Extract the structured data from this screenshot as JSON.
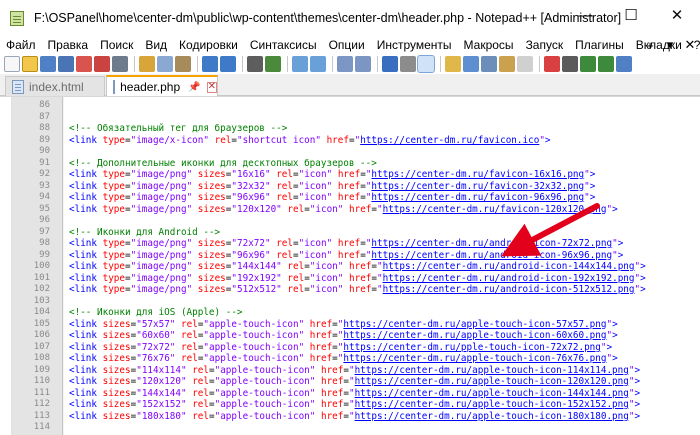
{
  "window": {
    "title": "F:\\OSPanel\\home\\center-dm\\public\\wp-content\\themes\\center-dm\\header.php - Notepad++ [Administrator]",
    "minimize": "—",
    "maximize": "☐",
    "close": "✕"
  },
  "menu": {
    "items": [
      "Файл",
      "Правка",
      "Поиск",
      "Вид",
      "Кодировки",
      "Синтаксисы",
      "Опции",
      "Инструменты",
      "Макросы",
      "Запуск",
      "Плагины",
      "Вкладки",
      "?"
    ],
    "right_plus": "+",
    "right_down": "▾",
    "right_close": "✕"
  },
  "tabs": [
    {
      "label": "index.html",
      "active": false
    },
    {
      "label": "header.php",
      "active": true
    }
  ],
  "colors": {
    "comment": "#008000",
    "tag": "#0000ff",
    "attribute": "#ff0000",
    "value": "#8000ff",
    "arrow": "#e3001b",
    "active_tab_accent": "#f6a300"
  },
  "editor": {
    "lines": [
      {
        "n": "86",
        "text": ""
      },
      {
        "n": "87",
        "text": ""
      },
      {
        "n": "88",
        "text": "<!-- Обязательный тег для браузеров -->"
      },
      {
        "n": "89",
        "text": "<link type=\"image/x-icon\" rel=\"shortcut icon\" href=\"https://center-dm.ru/favicon.ico\">"
      },
      {
        "n": "90",
        "text": ""
      },
      {
        "n": "91",
        "text": "<!-- Дополнительные иконки для десктопных браузеров -->"
      },
      {
        "n": "92",
        "text": "<link type=\"image/png\" sizes=\"16x16\" rel=\"icon\" href=\"https://center-dm.ru/favicon-16x16.png\">"
      },
      {
        "n": "93",
        "text": "<link type=\"image/png\" sizes=\"32x32\" rel=\"icon\" href=\"https://center-dm.ru/favicon-32x32.png\">"
      },
      {
        "n": "94",
        "text": "<link type=\"image/png\" sizes=\"96x96\" rel=\"icon\" href=\"https://center-dm.ru/favicon-96x96.png\">"
      },
      {
        "n": "95",
        "text": "<link type=\"image/png\" sizes=\"120x120\" rel=\"icon\" href=\"https://center-dm.ru/favicon-120x120.png\">"
      },
      {
        "n": "96",
        "text": ""
      },
      {
        "n": "97",
        "text": "<!-- Иконки для Android -->"
      },
      {
        "n": "98",
        "text": "<link type=\"image/png\" sizes=\"72x72\" rel=\"icon\" href=\"https://center-dm.ru/android-icon-72x72.png\">"
      },
      {
        "n": "99",
        "text": "<link type=\"image/png\" sizes=\"96x96\" rel=\"icon\" href=\"https://center-dm.ru/android-icon-96x96.png\">"
      },
      {
        "n": "100",
        "text": "<link type=\"image/png\" sizes=\"144x144\" rel=\"icon\" href=\"https://center-dm.ru/android-icon-144x144.png\">"
      },
      {
        "n": "101",
        "text": "<link type=\"image/png\" sizes=\"192x192\" rel=\"icon\" href=\"https://center-dm.ru/android-icon-192x192.png\">"
      },
      {
        "n": "102",
        "text": "<link type=\"image/png\" sizes=\"512x512\" rel=\"icon\" href=\"https://center-dm.ru/android-icon-512x512.png\">"
      },
      {
        "n": "103",
        "text": ""
      },
      {
        "n": "104",
        "text": "<!-- Иконки для iOS (Apple) -->"
      },
      {
        "n": "105",
        "text": "<link sizes=\"57x57\" rel=\"apple-touch-icon\" href=\"https://center-dm.ru/apple-touch-icon-57x57.png\">"
      },
      {
        "n": "106",
        "text": "<link sizes=\"60x60\" rel=\"apple-touch-icon\" href=\"https://center-dm.ru/apple-touch-icon-60x60.png\">"
      },
      {
        "n": "107",
        "text": "<link sizes=\"72x72\" rel=\"apple-touch-icon\" href=\"https://center-dm.ru/pple-touch-icon-72x72.png\">"
      },
      {
        "n": "108",
        "text": "<link sizes=\"76x76\" rel=\"apple-touch-icon\" href=\"https://center-dm.ru/apple-touch-icon-76x76.png\">"
      },
      {
        "n": "109",
        "text": "<link sizes=\"114x114\" rel=\"apple-touch-icon\" href=\"https://center-dm.ru/apple-touch-icon-114x114.png\">"
      },
      {
        "n": "110",
        "text": "<link sizes=\"120x120\" rel=\"apple-touch-icon\" href=\"https://center-dm.ru/apple-touch-icon-120x120.png\">"
      },
      {
        "n": "111",
        "text": "<link sizes=\"144x144\" rel=\"apple-touch-icon\" href=\"https://center-dm.ru/apple-touch-icon-144x144.png\">"
      },
      {
        "n": "112",
        "text": "<link sizes=\"152x152\" rel=\"apple-touch-icon\" href=\"https://center-dm.ru/apple-touch-icon-152x152.png\">"
      },
      {
        "n": "113",
        "text": "<link sizes=\"180x180\" rel=\"apple-touch-icon\" href=\"https://center-dm.ru/apple-touch-icon-180x180.png\">"
      },
      {
        "n": "114",
        "text": ""
      }
    ]
  }
}
